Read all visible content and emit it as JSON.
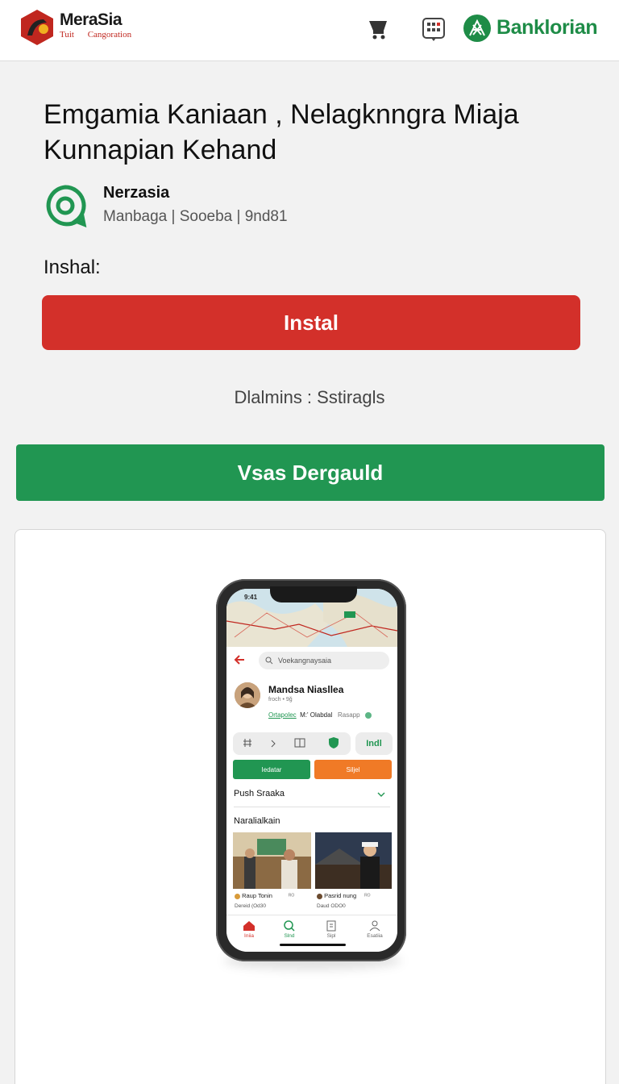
{
  "header": {
    "brand_name": "MeraSia",
    "brand_sub_left": "Tuit",
    "brand_sub_right": "Cangoration",
    "icons": [
      "cart-icon",
      "apps-icon"
    ],
    "partner_name": "Banklorian"
  },
  "app": {
    "title": "Emgamia Kaniaan , Nelagknngra Miaja Kunnapian Kehand",
    "publisher": "Nerzasia",
    "publisher_meta": "Manbaga | Sooeba | 9nd81",
    "install_label": "Inshal:",
    "install_button": "Instal",
    "details_text": "Dlalmins : Sstiragls",
    "secondary_button": "Vsas Dergauld"
  },
  "preview": {
    "search_placeholder": "Voekangnaysaia",
    "profile_name": "Mandsa Niasllea",
    "profile_sub": "froch • 9ǧ",
    "profile_link1": "Ortapolec",
    "profile_link2": "M:' Olabdal",
    "profile_link3": "Rasapp",
    "side_pill": "Indl",
    "green_btn": "Iedatar",
    "orange_btn": "Siljel",
    "section1": "Push Sraaka",
    "section2": "Naralialkain",
    "card1_title": "Raup Tonin",
    "card1_meta": "Dereid   (Od30",
    "card1_num": "ᴿᴼ",
    "card2_title": "Pasrid nung",
    "card2_meta": "Daud   ODO0",
    "card2_num": "ᴿᴼ",
    "nav": [
      "Iniia",
      "Slnd",
      "Sipl",
      "Esatiia"
    ],
    "colors": {
      "red": "#d3302a",
      "green": "#219652",
      "orange": "#f07a26"
    }
  }
}
